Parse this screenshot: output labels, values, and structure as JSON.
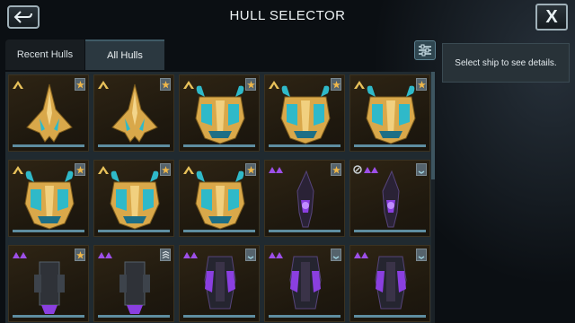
{
  "header": {
    "title": "HULL SELECTOR",
    "back_icon": "back-arrow-icon",
    "close_label": "X"
  },
  "tabs": [
    {
      "label": "Recent Hulls",
      "active": false
    },
    {
      "label": "All Hulls",
      "active": true
    }
  ],
  "filter_icon": "sliders-icon",
  "details": {
    "text": "Select ship to see details."
  },
  "colors": {
    "gold_ship": "#d9a84a",
    "teal_ship": "#2fb9c9",
    "purple_ship": "#8a3fe0",
    "rank_gold": "#e8c15a",
    "rank_purple": "#9d4fe8",
    "card_bar": "#5e8da0"
  },
  "cards": [
    {
      "ship": "gold-fighter",
      "rank": "gold-chevron",
      "badge": "star-icon"
    },
    {
      "ship": "gold-fighter",
      "rank": "gold-chevron",
      "badge": "star-icon"
    },
    {
      "ship": "gold-mask-ship",
      "rank": "gold-chevron",
      "badge": "star-icon"
    },
    {
      "ship": "gold-mask-ship",
      "rank": "gold-chevron",
      "badge": "star-icon"
    },
    {
      "ship": "gold-mask-ship",
      "rank": "gold-chevron",
      "badge": "star-icon"
    },
    {
      "ship": "gold-mask-ship",
      "rank": "gold-chevron",
      "badge": "star-icon"
    },
    {
      "ship": "gold-mask-ship",
      "rank": "gold-chevron",
      "badge": "star-icon"
    },
    {
      "ship": "gold-mask-ship",
      "rank": "gold-chevron",
      "badge": "star-icon"
    },
    {
      "ship": "purple-cruiser",
      "rank": "purple-chevrons",
      "badge": "star-icon"
    },
    {
      "ship": "purple-cruiser",
      "rank": "purple-chevrons-wrench",
      "badge": "rank-bar-icon"
    },
    {
      "ship": "dark-carrier",
      "rank": "purple-chevrons",
      "badge": "star-icon"
    },
    {
      "ship": "dark-carrier",
      "rank": "purple-chevrons",
      "badge": "triple-chevron-icon"
    },
    {
      "ship": "purple-battleship",
      "rank": "purple-chevrons",
      "badge": "rank-bar-icon"
    },
    {
      "ship": "purple-battleship",
      "rank": "purple-chevrons",
      "badge": "rank-bar-icon"
    },
    {
      "ship": "purple-battleship",
      "rank": "purple-chevrons",
      "badge": "rank-bar-icon"
    }
  ]
}
